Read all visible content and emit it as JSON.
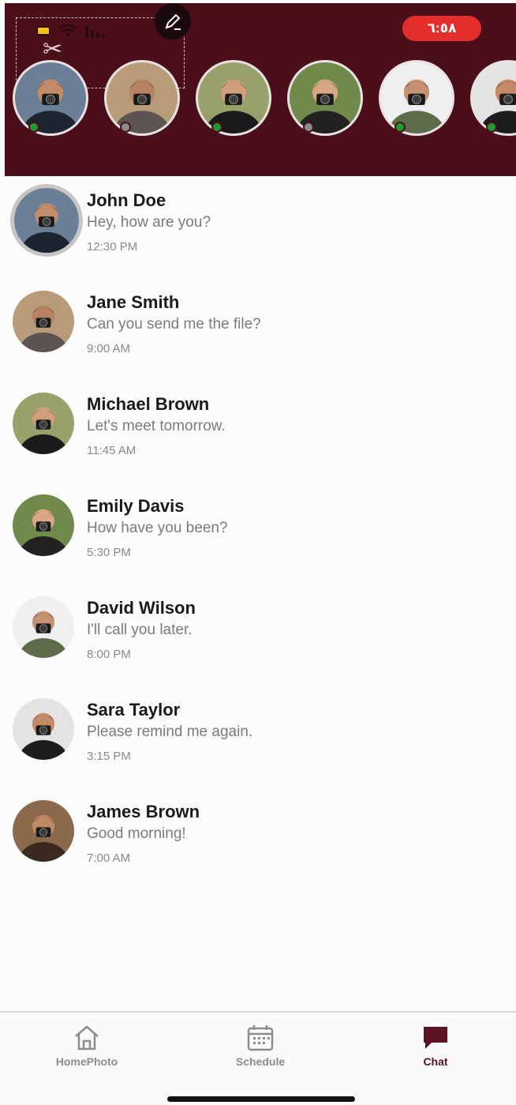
{
  "header": {
    "time": "٦:٥٨",
    "stories": [
      {
        "name": "story-1",
        "online": true,
        "bg": "#6b7f96",
        "shirt": "#1d2430",
        "skin": "#c58c69"
      },
      {
        "name": "story-2",
        "online": false,
        "bg": "#b89b78",
        "shirt": "#5b5452",
        "skin": "#b88360"
      },
      {
        "name": "story-3",
        "online": true,
        "bg": "#9aa06a",
        "shirt": "#1a1a1a",
        "skin": "#d1a07a"
      },
      {
        "name": "story-4",
        "online": false,
        "bg": "#6f8a4a",
        "shirt": "#222222",
        "skin": "#d8a886"
      },
      {
        "name": "story-5",
        "online": true,
        "bg": "#efefef",
        "shirt": "#5d6b4b",
        "skin": "#c69272"
      },
      {
        "name": "story-6",
        "online": true,
        "bg": "#e3e3e3",
        "shirt": "#1d1d1d",
        "skin": "#c48b66"
      }
    ],
    "online_color": "#1f9a2e",
    "offline_color": "#8e8a8b"
  },
  "chats": [
    {
      "name": "John Doe",
      "message": "Hey, how are you?",
      "time": "12:30 PM",
      "bg": "#6b7f96",
      "shirt": "#1d2430",
      "skin": "#c58c69"
    },
    {
      "name": "Jane Smith",
      "message": "Can you send me the file?",
      "time": "9:00 AM",
      "bg": "#b89b78",
      "shirt": "#5b5452",
      "skin": "#b88360"
    },
    {
      "name": "Michael Brown",
      "message": "Let's meet tomorrow.",
      "time": "11:45 AM",
      "bg": "#9aa06a",
      "shirt": "#1a1a1a",
      "skin": "#d1a07a"
    },
    {
      "name": "Emily Davis",
      "message": "How have you been?",
      "time": "5:30 PM",
      "bg": "#6f8a4a",
      "shirt": "#222222",
      "skin": "#d8a886"
    },
    {
      "name": "David Wilson",
      "message": "I'll call you later.",
      "time": "8:00 PM",
      "bg": "#efefef",
      "shirt": "#5d6b4b",
      "skin": "#c69272"
    },
    {
      "name": "Sara Taylor",
      "message": "Please remind me again.",
      "time": "3:15 PM",
      "bg": "#e3e3e3",
      "shirt": "#1d1d1d",
      "skin": "#c48b66"
    },
    {
      "name": "James Brown",
      "message": "Good morning!",
      "time": "7:00 AM",
      "bg": "#8a6a4a",
      "shirt": "#3a2a20",
      "skin": "#c08a62"
    }
  ],
  "nav": {
    "home_label": "HomePhoto",
    "schedule_label": "Schedule",
    "chat_label": "Chat",
    "active": "Chat",
    "active_color": "#5a1421",
    "inactive_color": "#8f8a8b"
  },
  "colors": {
    "header_bg": "#4a0f1b",
    "time_pill": "#e32e2c"
  }
}
